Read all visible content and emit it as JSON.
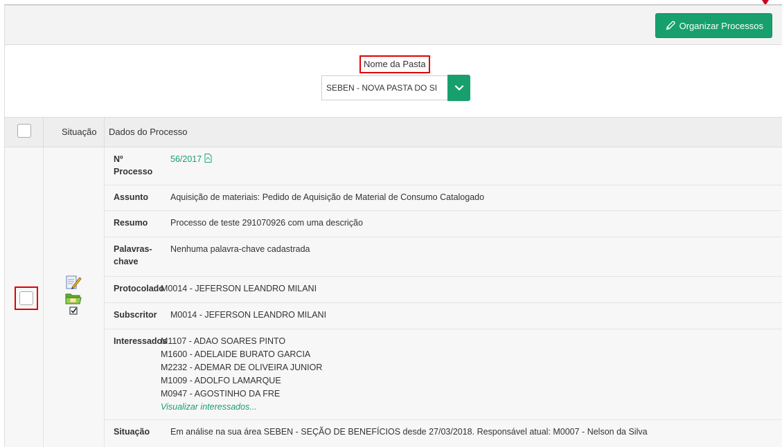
{
  "toolbar": {
    "organize_button": "Organizar Processos",
    "organize_icon": "pencil-icon"
  },
  "folder": {
    "label": "Nome da Pasta",
    "selected": "SEBEN - NOVA PASTA DO SI",
    "dropdown_icon": "chevron-down-icon"
  },
  "table": {
    "headers": {
      "situacao": "Situação",
      "dados": "Dados do Processo"
    }
  },
  "process": {
    "numero_label": "Nº Processo",
    "numero_label_line1": "Nº",
    "numero_label_line2": "Processo",
    "numero": "56/2017",
    "assunto_label": "Assunto",
    "assunto": "Aquisição de materiais: Pedido de Aquisição de Material de Consumo Catalogado",
    "resumo_label": "Resumo",
    "resumo": "Processo de teste 291070926 com uma descrição",
    "palavras_label_line1": "Palavras-",
    "palavras_label_line2": "chave",
    "palavras": "Nenhuma palavra-chave cadastrada",
    "protocolado_label": "Protocolado",
    "protocolado": "M0014 - JEFERSON LEANDRO MILANI",
    "subscritor_label": "Subscritor",
    "subscritor": "M0014 - JEFERSON LEANDRO MILANI",
    "interessados_label": "Interessados",
    "interessados": [
      "M1107 - ADAO SOARES PINTO",
      "M1600 - ADELAIDE BURATO GARCIA",
      "M2232 - ADEMAR DE OLIVEIRA JUNIOR",
      "M1009 - ADOLFO LAMARQUE",
      "M0947 - AGOSTINHO DA FRE"
    ],
    "visualizar_interessados": "Visualizar interessados...",
    "situacao_label": "Situação",
    "situacao": "Em análise na sua área SEBEN - SEÇÃO DE BENEFÍCIOS desde 27/03/2018. Responsável atual: M0007 - Nelson da Silva"
  },
  "colors": {
    "accent": "#17a06e",
    "highlight": "#e00000"
  }
}
